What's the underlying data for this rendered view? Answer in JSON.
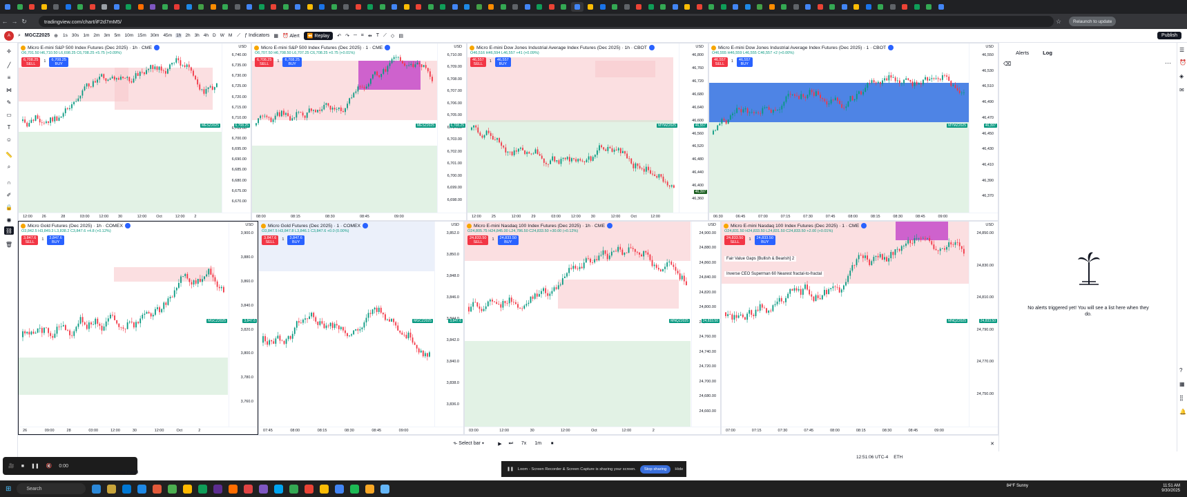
{
  "browser": {
    "url": "tradingview.com/chart/iF2d7mM5/",
    "relaunch_label": "Relaunch to update",
    "tab_colors": [
      "#4285f4",
      "#34a853",
      "#ea4335",
      "#fbbc05",
      "#5f6368",
      "#1a73e8",
      "#34a853",
      "#ea4335",
      "#9aa0a6",
      "#4285f4",
      "#0f9d58",
      "#ff6d00",
      "#7e57c2",
      "#34a853",
      "#e53935",
      "#1e88e5",
      "#43a047",
      "#fb8c00",
      "#34a853",
      "#5f6368",
      "#4285f4",
      "#0f9d58",
      "#ea4335",
      "#34a853",
      "#4285f4",
      "#fbbc05",
      "#1a73e8",
      "#34a853",
      "#5f6368",
      "#ea4335",
      "#0f9d58",
      "#34a853",
      "#4285f4",
      "#fbbc05",
      "#ea4335",
      "#34a853",
      "#0f9d58",
      "#4285f4",
      "#1e88e5",
      "#43a047",
      "#fb8c00",
      "#34a853",
      "#5f6368",
      "#4285f4",
      "#0f9d58",
      "#ea4335",
      "#34a853",
      "#4285f4",
      "#fbbc05",
      "#1a73e8",
      "#34a853",
      "#5f6368",
      "#ea4335",
      "#0f9d58",
      "#34a853",
      "#4285f4",
      "#fbbc05",
      "#ea4335",
      "#34a853",
      "#0f9d58",
      "#4285f4",
      "#1e88e5",
      "#43a047",
      "#fb8c00",
      "#34a853",
      "#5f6368",
      "#4285f4",
      "#ea4335",
      "#34a853",
      "#4285f4",
      "#fbbc05",
      "#1a73e8",
      "#34a853",
      "#5f6368",
      "#ea4335",
      "#0f9d58",
      "#34a853",
      "#4285f4"
    ]
  },
  "toolbar": {
    "avatar": "A",
    "symbol": "MGCZ2025",
    "timeframes": [
      "1s",
      "30s",
      "1m",
      "2m",
      "3m",
      "5m",
      "10m",
      "15m",
      "30m",
      "45m",
      "1h",
      "2h",
      "3h",
      "4h",
      "D",
      "W",
      "M"
    ],
    "indicators_label": "Indicators",
    "alert_label": "Alert",
    "replay_label": "Replay",
    "publish_label": "Publish"
  },
  "panels": [
    {
      "title": "Micro E-mini S&P 500 Index Futures (Dec 2025) · 1h · CME",
      "ohlc": "O6,701.50 H6,710.50 L6,698.25 C6,708.25 +5.75 (+0.09%)",
      "sell": "6,708.25",
      "buy": "6,708.25",
      "qty": "1",
      "currency": "USD",
      "yticks": [
        "6,740.00",
        "6,735.00",
        "6,730.00",
        "6,725.00",
        "6,720.00",
        "6,715.00",
        "6,710.00",
        "6,705.00",
        "6,700.00",
        "6,695.00",
        "6,690.00",
        "6,685.00",
        "6,680.00",
        "6,675.00",
        "6,670.00"
      ],
      "xticks": [
        "12:00",
        "26",
        "28",
        "03:00",
        "12:00",
        "30",
        "12:00",
        "Oct",
        "12:00",
        "2"
      ],
      "tag": "MESZ2025",
      "tag_price": "6,708.25"
    },
    {
      "title": "Micro E-mini S&P 500 Index Futures (Dec 2025) · 1 · CME",
      "ohlc": "O6,707.50 H6,708.50 L6,707.25 C6,708.25 +0.75 (+0.01%)",
      "sell": "6,708.25",
      "buy": "6,708.25",
      "qty": "1",
      "currency": "USD",
      "yticks": [
        "6,710.00",
        "6,709.00",
        "6,708.00",
        "6,707.00",
        "6,706.00",
        "6,705.00",
        "6,704.00",
        "6,703.00",
        "6,702.00",
        "6,701.00",
        "6,700.00",
        "6,699.00",
        "6,698.00"
      ],
      "xticks": [
        "08:00",
        "08:15",
        "08:30",
        "08:45",
        "09:00"
      ],
      "tag": "MESZ2025",
      "tag_price": "6,708.25"
    },
    {
      "title": "Micro E-mini Dow Jones Industrial Average Index Futures (Dec 2025) · 1h · CBOT",
      "ohlc": "O46,516 H46,594 L46,557 +41 (+0.09%)",
      "sell": "46,557",
      "buy": "46,557",
      "qty": "1",
      "currency": "USD",
      "yticks": [
        "46,800",
        "46,760",
        "46,720",
        "46,680",
        "46,640",
        "46,600",
        "46,560",
        "46,520",
        "46,480",
        "46,440",
        "46,400",
        "46,360"
      ],
      "xticks": [
        "12:00",
        "25",
        "12:00",
        "29",
        "03:00",
        "12:00",
        "30",
        "12:00",
        "Oct",
        "12:00"
      ],
      "tag": "MYMZ2025",
      "tag_price": "46,557",
      "tag2_price": "46,397"
    },
    {
      "title": "Micro E-mini Dow Jones Industrial Average Index Futures (Dec 2025) · 1 · CBOT",
      "ohlc": "O46,555 H46,559 L46,555 C46,557 +2 (+0.00%)",
      "sell": "46,557",
      "buy": "46,557",
      "qty": "1",
      "currency": "USD",
      "yticks": [
        "46,550",
        "46,530",
        "46,510",
        "46,490",
        "46,470",
        "46,450",
        "46,430",
        "46,410",
        "46,390",
        "46,370"
      ],
      "xticks": [
        "06:30",
        "06:45",
        "07:00",
        "07:15",
        "07:30",
        "07:45",
        "08:00",
        "08:15",
        "08:30",
        "08:45",
        "09:00"
      ],
      "tag": "MYMZ2025",
      "tag_price": "46,397"
    },
    {
      "title": "Micro Gold Futures (Dec 2025) · 1h · COMEX",
      "ohlc": "O3,842.5 H3,849.3 L3,838.2 C3,847.6 +4.8 (+0.12%)",
      "sell": "3,847.6",
      "buy": "3,847.6",
      "qty": "1",
      "currency": "USD",
      "yticks": [
        "3,900.0",
        "3,880.0",
        "3,860.0",
        "3,840.0",
        "3,820.0",
        "3,800.0",
        "3,780.0",
        "3,760.0"
      ],
      "xticks": [
        "26",
        "09:00",
        "28",
        "03:00",
        "12:00",
        "30",
        "12:00",
        "Oct",
        "2"
      ],
      "tag": "MGCZ2025",
      "tag_price": "3,847.6"
    },
    {
      "title": "Micro Gold Futures (Dec 2025) · 1 · COMEX",
      "ohlc": "O3,847.5 H3,847.8 L3,846.1 C3,847.6 +0.0 (0.00%)",
      "sell": "3,847.6",
      "buy": "3,847.6",
      "qty": "1",
      "currency": "USD",
      "yticks": [
        "3,852.0",
        "3,850.0",
        "3,848.0",
        "3,846.0",
        "3,844.0",
        "3,842.0",
        "3,840.0",
        "3,838.0",
        "3,836.0"
      ],
      "xticks": [
        "07:45",
        "08:00",
        "08:15",
        "08:30",
        "08:45",
        "09:00"
      ],
      "tag": "MGCZ2025",
      "tag_price": "3,847.6"
    },
    {
      "title": "Micro E-mini Nasdaq 100 Index Futures (Dec 2025) · 1h · CME",
      "ohlc": "O24,805.75 H24,845.00 L24,786.50 C24,833.50 +30.00 (+0.12%)",
      "sell": "24,833.50",
      "buy": "24,833.50",
      "qty": "1",
      "currency": "USD",
      "yticks": [
        "24,900.00",
        "24,880.00",
        "24,860.00",
        "24,840.00",
        "24,820.00",
        "24,800.00",
        "24,780.00",
        "24,760.00",
        "24,740.00",
        "24,720.00",
        "24,700.00",
        "24,680.00",
        "24,660.00"
      ],
      "xticks": [
        "03:00",
        "12:00",
        "30",
        "12:00",
        "Oct",
        "12:00",
        "2"
      ],
      "tag": "MNQZ2025",
      "tag_price": "24,833.50"
    },
    {
      "title": "Micro E-mini Nasdaq 100 Index Futures (Dec 2025) · 1 · CME",
      "ohlc": "O24,831.50 H24,833.50 L24,831.50 C24,833.50 +2.00 (+0.01%)",
      "sell": "24,833.50",
      "buy": "24,833.50",
      "qty": "1",
      "currency": "USD",
      "yticks": [
        "24,850.00",
        "24,830.00",
        "24,810.00",
        "24,790.00",
        "24,770.00",
        "24,750.00"
      ],
      "xticks": [
        "07:00",
        "07:15",
        "07:30",
        "07:45",
        "08:00",
        "08:15",
        "08:30",
        "08:45",
        "09:00"
      ],
      "tag": "MNQZ2025",
      "tag_price": "24,833.50",
      "indicator1": "Fair Value Gaps [Bullish & Bearish] 2",
      "indicator2": "Inverse CEO Superman 60 Nearest fractal-to-fractal"
    }
  ],
  "replaybar": {
    "select_bar": "Select bar",
    "speed": "7x",
    "interval": "1m",
    "clock": "12:51:06 UTC-4",
    "session": "ETH"
  },
  "alerts": {
    "tab_alerts": "Alerts",
    "tab_log": "Log",
    "empty_message": "No alerts triggered yet! You will see a list here when they do."
  },
  "loom": {
    "message": "Loom - Screen Recorder & Screen Capture is sharing your screen.",
    "stop": "Stop sharing",
    "hide": "Hide"
  },
  "recorder": {
    "time": "0:00"
  },
  "bottom_label": "Trading Panel",
  "taskbar": {
    "search": "Search",
    "weather": "84°F Sunny",
    "time": "11:51 AM",
    "date": "9/30/2025"
  },
  "colors": {
    "up": "#089981",
    "down": "#f23645",
    "zone_red": "#f8c9cd",
    "zone_green": "#cfe9d4",
    "zone_blue": "#2f6fe0",
    "zone_magenta": "#c342c8",
    "zone_lightblue": "#dde6f7"
  }
}
